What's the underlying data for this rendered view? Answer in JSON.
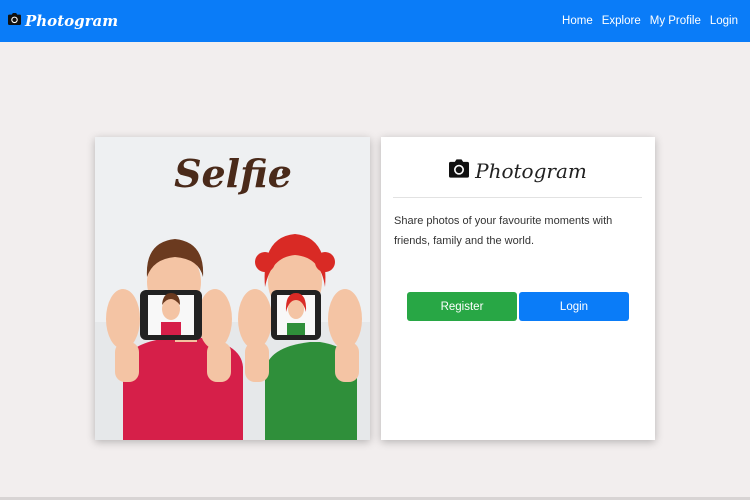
{
  "navbar": {
    "brand": "Photogram",
    "links": [
      "Home",
      "Explore",
      "My Profile",
      "Login"
    ]
  },
  "hero_image": {
    "title": "Selfie"
  },
  "card": {
    "brand": "Photogram",
    "description": "Share photos of your favourite moments with friends, family and the world.",
    "register_label": "Register",
    "login_label": "Login"
  },
  "colors": {
    "primary": "#0a7cf8",
    "success": "#28a745",
    "background": "#f2eeee"
  },
  "icons": {
    "brand": "camera-icon"
  }
}
